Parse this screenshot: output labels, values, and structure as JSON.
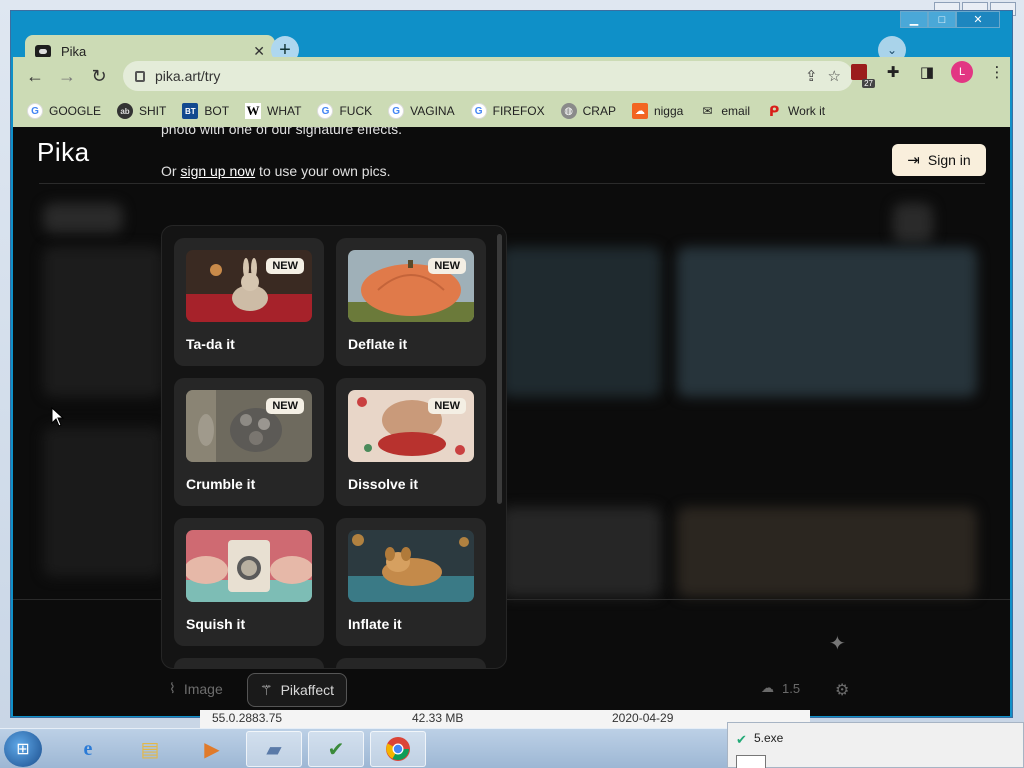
{
  "browser": {
    "tab_title": "Pika",
    "url": "pika.art/try",
    "avatar_letter": "L",
    "ext_badge": "27"
  },
  "bookmarks": [
    {
      "label": "GOOGLE",
      "icon": "google-icon"
    },
    {
      "label": "SHIT",
      "icon": "site-icon"
    },
    {
      "label": "BOT",
      "icon": "bt-icon"
    },
    {
      "label": "WHAT",
      "icon": "wikipedia-icon"
    },
    {
      "label": "FUCK",
      "icon": "google-icon"
    },
    {
      "label": "VAGINA",
      "icon": "google-icon"
    },
    {
      "label": "FIREFOX",
      "icon": "google-icon"
    },
    {
      "label": "CRAP",
      "icon": "globe-icon"
    },
    {
      "label": "nigga",
      "icon": "soundcloud-icon"
    },
    {
      "label": "email",
      "icon": "mail-icon"
    },
    {
      "label": "Work it",
      "icon": "pinterest-icon"
    }
  ],
  "page": {
    "logo": "Pika",
    "intro_line1": "photo with one of our signature effects.",
    "intro_or": "Or ",
    "intro_link": "sign up now",
    "intro_rest": " to use your own pics.",
    "signin_label": "Sign in"
  },
  "effects": [
    {
      "label": "Ta-da it",
      "badge": "NEW",
      "thumb": "bunny"
    },
    {
      "label": "Deflate it",
      "badge": "NEW",
      "thumb": "pumpkin"
    },
    {
      "label": "Crumble it",
      "badge": "NEW",
      "thumb": "crumble"
    },
    {
      "label": "Dissolve it",
      "badge": "NEW",
      "thumb": "dissolve"
    },
    {
      "label": "Squish it",
      "badge": "",
      "thumb": "squish"
    },
    {
      "label": "Inflate it",
      "badge": "",
      "thumb": "puppy"
    }
  ],
  "prompt_bar": {
    "image_label": "Image",
    "pikaffect_label": "Pikaffect",
    "credits": "1.5"
  },
  "background_strip": {
    "version": "55.0.2883.75",
    "size": "42.33 MB",
    "date": "2020-04-29"
  },
  "popup": {
    "title": "5.exe"
  },
  "colors": {
    "chrome_frame": "#ccdbb5",
    "window_accent": "#0f90c8",
    "page_bg": "#0c0c0c",
    "signin_bg": "#f9efdc",
    "badge_bg": "#f4efe4"
  }
}
